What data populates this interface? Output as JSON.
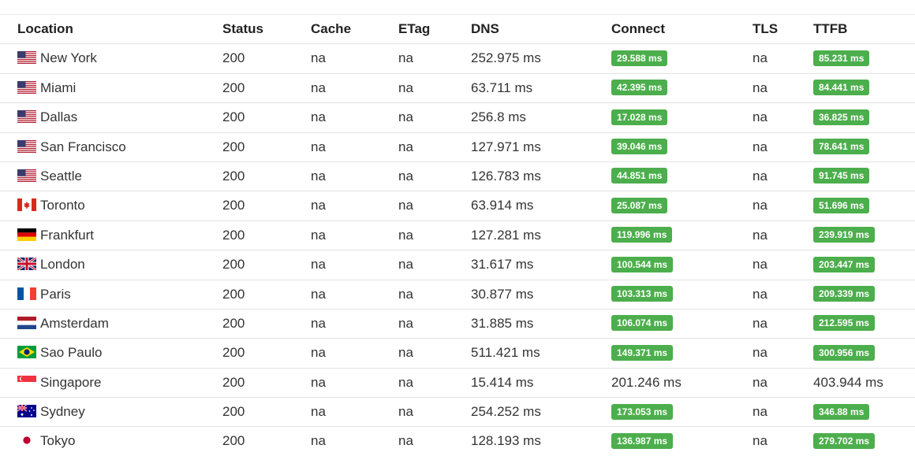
{
  "table": {
    "headers": {
      "location": "Location",
      "status": "Status",
      "cache": "Cache",
      "etag": "ETag",
      "dns": "DNS",
      "connect": "Connect",
      "tls": "TLS",
      "ttfb": "TTFB"
    },
    "badge_color": "#4cae4c",
    "rows": [
      {
        "flag": "us-flag-icon",
        "location": "New York",
        "status": "200",
        "cache": "na",
        "etag": "na",
        "dns": "252.975 ms",
        "connect": "29.588 ms",
        "connect_badge": true,
        "tls": "na",
        "ttfb": "85.231 ms",
        "ttfb_badge": true
      },
      {
        "flag": "us-flag-icon",
        "location": "Miami",
        "status": "200",
        "cache": "na",
        "etag": "na",
        "dns": "63.711 ms",
        "connect": "42.395 ms",
        "connect_badge": true,
        "tls": "na",
        "ttfb": "84.441 ms",
        "ttfb_badge": true
      },
      {
        "flag": "us-flag-icon",
        "location": "Dallas",
        "status": "200",
        "cache": "na",
        "etag": "na",
        "dns": "256.8 ms",
        "connect": "17.028 ms",
        "connect_badge": true,
        "tls": "na",
        "ttfb": "36.825 ms",
        "ttfb_badge": true
      },
      {
        "flag": "us-flag-icon",
        "location": "San Francisco",
        "status": "200",
        "cache": "na",
        "etag": "na",
        "dns": "127.971 ms",
        "connect": "39.046 ms",
        "connect_badge": true,
        "tls": "na",
        "ttfb": "78.641 ms",
        "ttfb_badge": true
      },
      {
        "flag": "us-flag-icon",
        "location": "Seattle",
        "status": "200",
        "cache": "na",
        "etag": "na",
        "dns": "126.783 ms",
        "connect": "44.851 ms",
        "connect_badge": true,
        "tls": "na",
        "ttfb": "91.745 ms",
        "ttfb_badge": true
      },
      {
        "flag": "ca-flag-icon",
        "location": "Toronto",
        "status": "200",
        "cache": "na",
        "etag": "na",
        "dns": "63.914 ms",
        "connect": "25.087 ms",
        "connect_badge": true,
        "tls": "na",
        "ttfb": "51.696 ms",
        "ttfb_badge": true
      },
      {
        "flag": "de-flag-icon",
        "location": "Frankfurt",
        "status": "200",
        "cache": "na",
        "etag": "na",
        "dns": "127.281 ms",
        "connect": "119.996 ms",
        "connect_badge": true,
        "tls": "na",
        "ttfb": "239.919 ms",
        "ttfb_badge": true
      },
      {
        "flag": "gb-flag-icon",
        "location": "London",
        "status": "200",
        "cache": "na",
        "etag": "na",
        "dns": "31.617 ms",
        "connect": "100.544 ms",
        "connect_badge": true,
        "tls": "na",
        "ttfb": "203.447 ms",
        "ttfb_badge": true
      },
      {
        "flag": "fr-flag-icon",
        "location": "Paris",
        "status": "200",
        "cache": "na",
        "etag": "na",
        "dns": "30.877 ms",
        "connect": "103.313 ms",
        "connect_badge": true,
        "tls": "na",
        "ttfb": "209.339 ms",
        "ttfb_badge": true
      },
      {
        "flag": "nl-flag-icon",
        "location": "Amsterdam",
        "status": "200",
        "cache": "na",
        "etag": "na",
        "dns": "31.885 ms",
        "connect": "106.074 ms",
        "connect_badge": true,
        "tls": "na",
        "ttfb": "212.595 ms",
        "ttfb_badge": true
      },
      {
        "flag": "br-flag-icon",
        "location": "Sao Paulo",
        "status": "200",
        "cache": "na",
        "etag": "na",
        "dns": "511.421 ms",
        "connect": "149.371 ms",
        "connect_badge": true,
        "tls": "na",
        "ttfb": "300.956 ms",
        "ttfb_badge": true
      },
      {
        "flag": "sg-flag-icon",
        "location": "Singapore",
        "status": "200",
        "cache": "na",
        "etag": "na",
        "dns": "15.414 ms",
        "connect": "201.246 ms",
        "connect_badge": false,
        "tls": "na",
        "ttfb": "403.944 ms",
        "ttfb_badge": false
      },
      {
        "flag": "au-flag-icon",
        "location": "Sydney",
        "status": "200",
        "cache": "na",
        "etag": "na",
        "dns": "254.252 ms",
        "connect": "173.053 ms",
        "connect_badge": true,
        "tls": "na",
        "ttfb": "346.88 ms",
        "ttfb_badge": true
      },
      {
        "flag": "jp-flag-icon",
        "location": "Tokyo",
        "status": "200",
        "cache": "na",
        "etag": "na",
        "dns": "128.193 ms",
        "connect": "136.987 ms",
        "connect_badge": true,
        "tls": "na",
        "ttfb": "279.702 ms",
        "ttfb_badge": true
      }
    ]
  }
}
